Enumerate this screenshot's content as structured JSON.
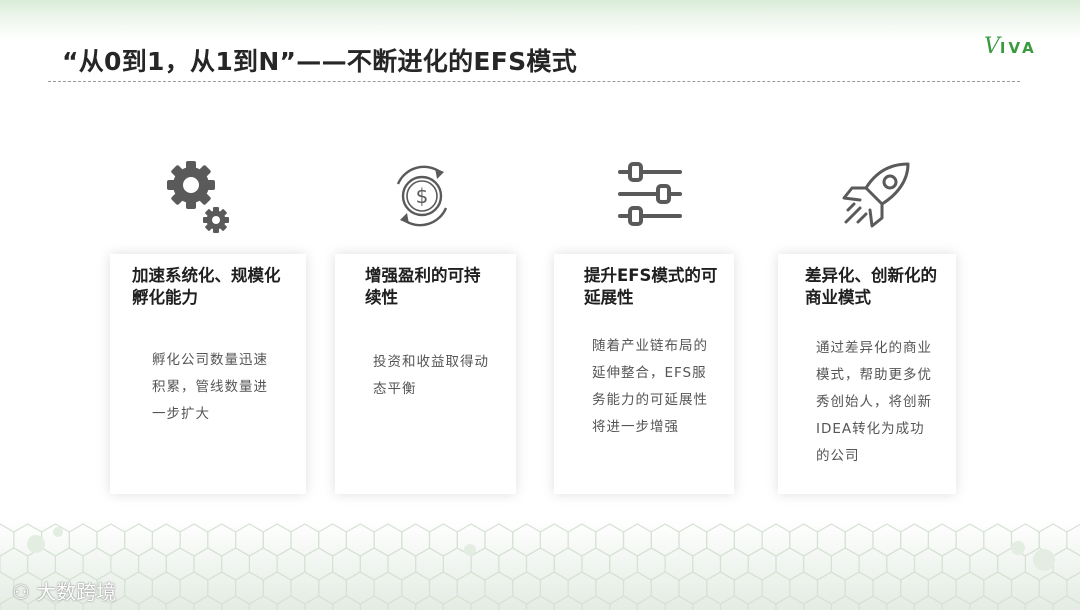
{
  "slide": {
    "title": "“从0到1，从1到N”——不断进化的EFS模式",
    "logo": {
      "v": "V",
      "rest": "IVA"
    },
    "watermark": "大数跨境"
  },
  "colors": {
    "brand": "#3a9a3e",
    "icon": "#5a5a5a"
  },
  "cards": [
    {
      "icon": "gears-icon",
      "title": "加速系统化、规模化孵化能力",
      "body": "孵化公司数量迅速积累，管线数量进一步扩大"
    },
    {
      "icon": "dollar-cycle-icon",
      "title": "增强盈利的可持续性",
      "body": "投资和收益取得动态平衡"
    },
    {
      "icon": "sliders-icon",
      "title": "提升EFS模式的可延展性",
      "body": "随着产业链布局的延伸整合，EFS服务能力的可延展性将进一步增强"
    },
    {
      "icon": "rocket-icon",
      "title": "差异化、创新化的商业模式",
      "body": "通过差异化的商业模式，帮助更多优秀创始人，将创新IDEA转化为成功的公司"
    }
  ]
}
